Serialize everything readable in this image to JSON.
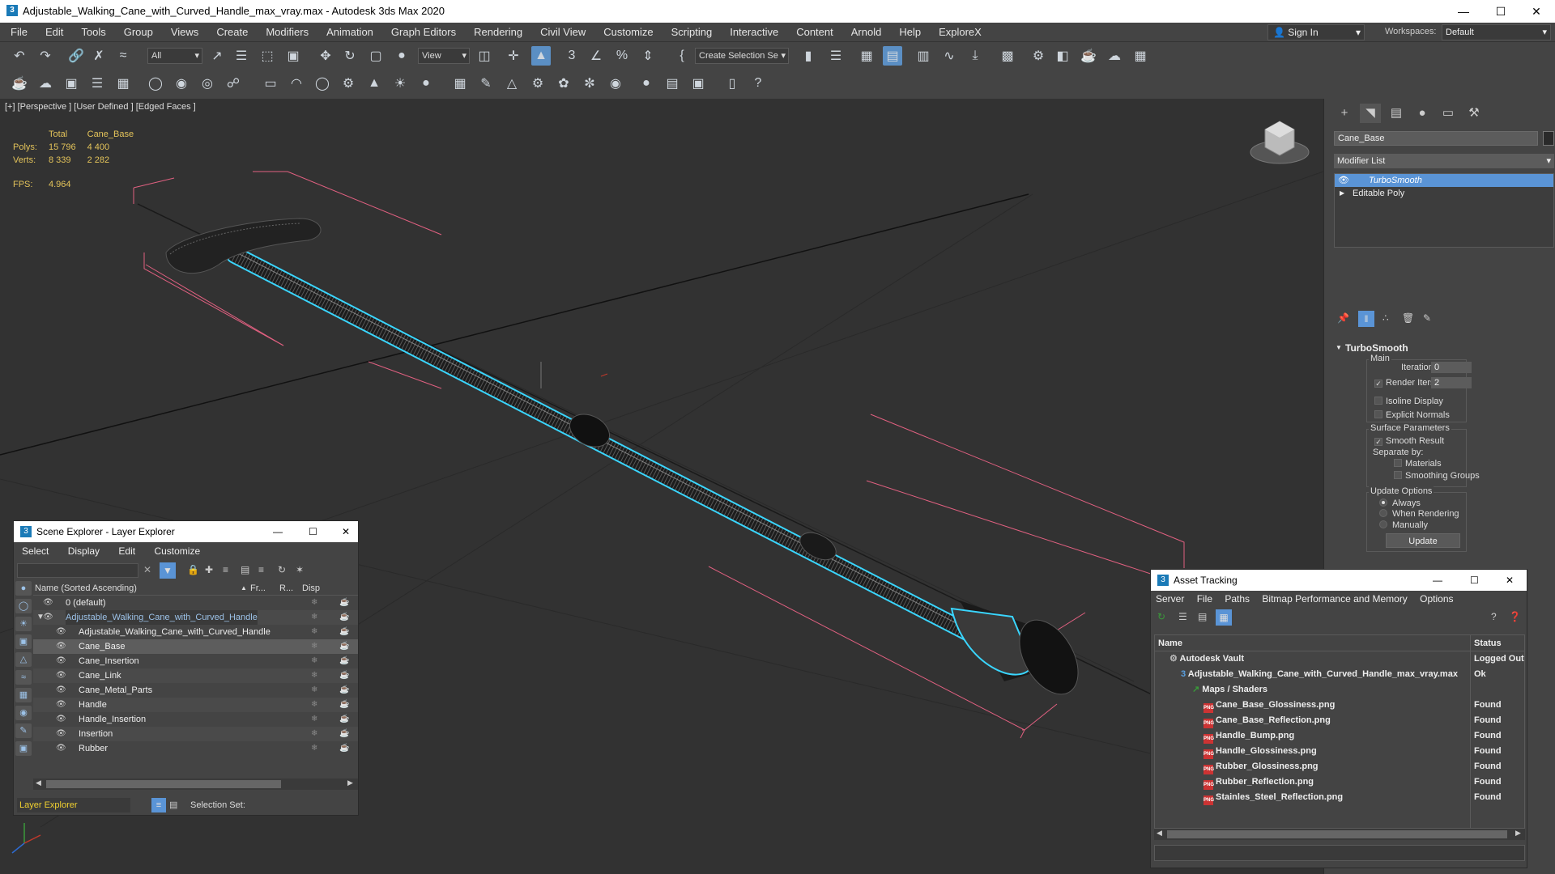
{
  "window": {
    "title": "Adjustable_Walking_Cane_with_Curved_Handle_max_vray.max - Autodesk 3ds Max 2020",
    "app_icon": "3"
  },
  "menu": [
    "File",
    "Edit",
    "Tools",
    "Group",
    "Views",
    "Create",
    "Modifiers",
    "Animation",
    "Graph Editors",
    "Rendering",
    "Civil View",
    "Customize",
    "Scripting",
    "Interactive",
    "Content",
    "Arnold",
    "Help",
    "ExploreX"
  ],
  "account": {
    "sign_in": "Sign In",
    "workspaces_label": "Workspaces:",
    "workspace": "Default"
  },
  "toolbar": {
    "filter": "All",
    "ref_coord": "View",
    "selection_set": "Create Selection Se"
  },
  "viewport": {
    "label": "[+] [Perspective ] [User Defined ] [Edged Faces ]",
    "stats": {
      "total_label": "Total",
      "object_label": "Cane_Base",
      "polys_label": "Polys:",
      "polys_total": "15 796",
      "polys_obj": "4 400",
      "verts_label": "Verts:",
      "verts_total": "8 339",
      "verts_obj": "2 282",
      "fps_label": "FPS:",
      "fps": "4.964"
    }
  },
  "command_panel": {
    "object_name": "Cane_Base",
    "modifier_list": "Modifier List",
    "stack": [
      "TurboSmooth",
      "Editable Poly"
    ],
    "rollout_title": "TurboSmooth",
    "main_label": "Main",
    "iterations_label": "Iterations:",
    "iterations": "0",
    "render_iters_label": "Render Iters:",
    "render_iters": "2",
    "isoline": "Isoline Display",
    "explicit_normals": "Explicit Normals",
    "surface_params": "Surface Parameters",
    "smooth_result": "Smooth Result",
    "separate_by": "Separate by:",
    "materials": "Materials",
    "smoothing_groups": "Smoothing Groups",
    "update_options": "Update Options",
    "always": "Always",
    "when_rendering": "When Rendering",
    "manually": "Manually",
    "update_btn": "Update"
  },
  "scene_explorer": {
    "title": "Scene Explorer - Layer Explorer",
    "menu": [
      "Select",
      "Display",
      "Edit",
      "Customize"
    ],
    "columns": {
      "name": "Name (Sorted Ascending)",
      "freeze": "Fr...",
      "render": "R...",
      "display": "Disp"
    },
    "rows": [
      {
        "name": "0 (default)",
        "indent": 0
      },
      {
        "name": "Adjustable_Walking_Cane_with_Curved_Handle",
        "indent": 0
      },
      {
        "name": "Adjustable_Walking_Cane_with_Curved_Handle",
        "indent": 1
      },
      {
        "name": "Cane_Base",
        "indent": 1
      },
      {
        "name": "Cane_Insertion",
        "indent": 1
      },
      {
        "name": "Cane_Link",
        "indent": 1
      },
      {
        "name": "Cane_Metal_Parts",
        "indent": 1
      },
      {
        "name": "Handle",
        "indent": 1
      },
      {
        "name": "Handle_Insertion",
        "indent": 1
      },
      {
        "name": "Insertion",
        "indent": 1
      },
      {
        "name": "Rubber",
        "indent": 1
      }
    ],
    "footer_layer": "Layer Explorer",
    "footer_selection": "Selection Set:"
  },
  "asset_tracking": {
    "title": "Asset Tracking",
    "menu": [
      "Server",
      "File",
      "Paths",
      "Bitmap Performance and Memory",
      "Options"
    ],
    "columns": {
      "name": "Name",
      "status": "Status"
    },
    "rows": [
      {
        "name": "Autodesk Vault",
        "status": "Logged Out",
        "indent": 1
      },
      {
        "name": "Adjustable_Walking_Cane_with_Curved_Handle_max_vray.max",
        "status": "Ok",
        "indent": 2
      },
      {
        "name": "Maps / Shaders",
        "status": "",
        "indent": 3
      },
      {
        "name": "Cane_Base_Glossiness.png",
        "status": "Found",
        "indent": 4
      },
      {
        "name": "Cane_Base_Reflection.png",
        "status": "Found",
        "indent": 4
      },
      {
        "name": "Handle_Bump.png",
        "status": "Found",
        "indent": 4
      },
      {
        "name": "Handle_Glossiness.png",
        "status": "Found",
        "indent": 4
      },
      {
        "name": "Rubber_Glossiness.png",
        "status": "Found",
        "indent": 4
      },
      {
        "name": "Rubber_Reflection.png",
        "status": "Found",
        "indent": 4
      },
      {
        "name": "Stainles_Steel_Reflection.png",
        "status": "Found",
        "indent": 4
      }
    ]
  },
  "colors": {
    "accent": "#5a94d6",
    "selection_outline": "#3ad6ff",
    "bbox": "#e06080",
    "stats": "#e3c35a"
  }
}
